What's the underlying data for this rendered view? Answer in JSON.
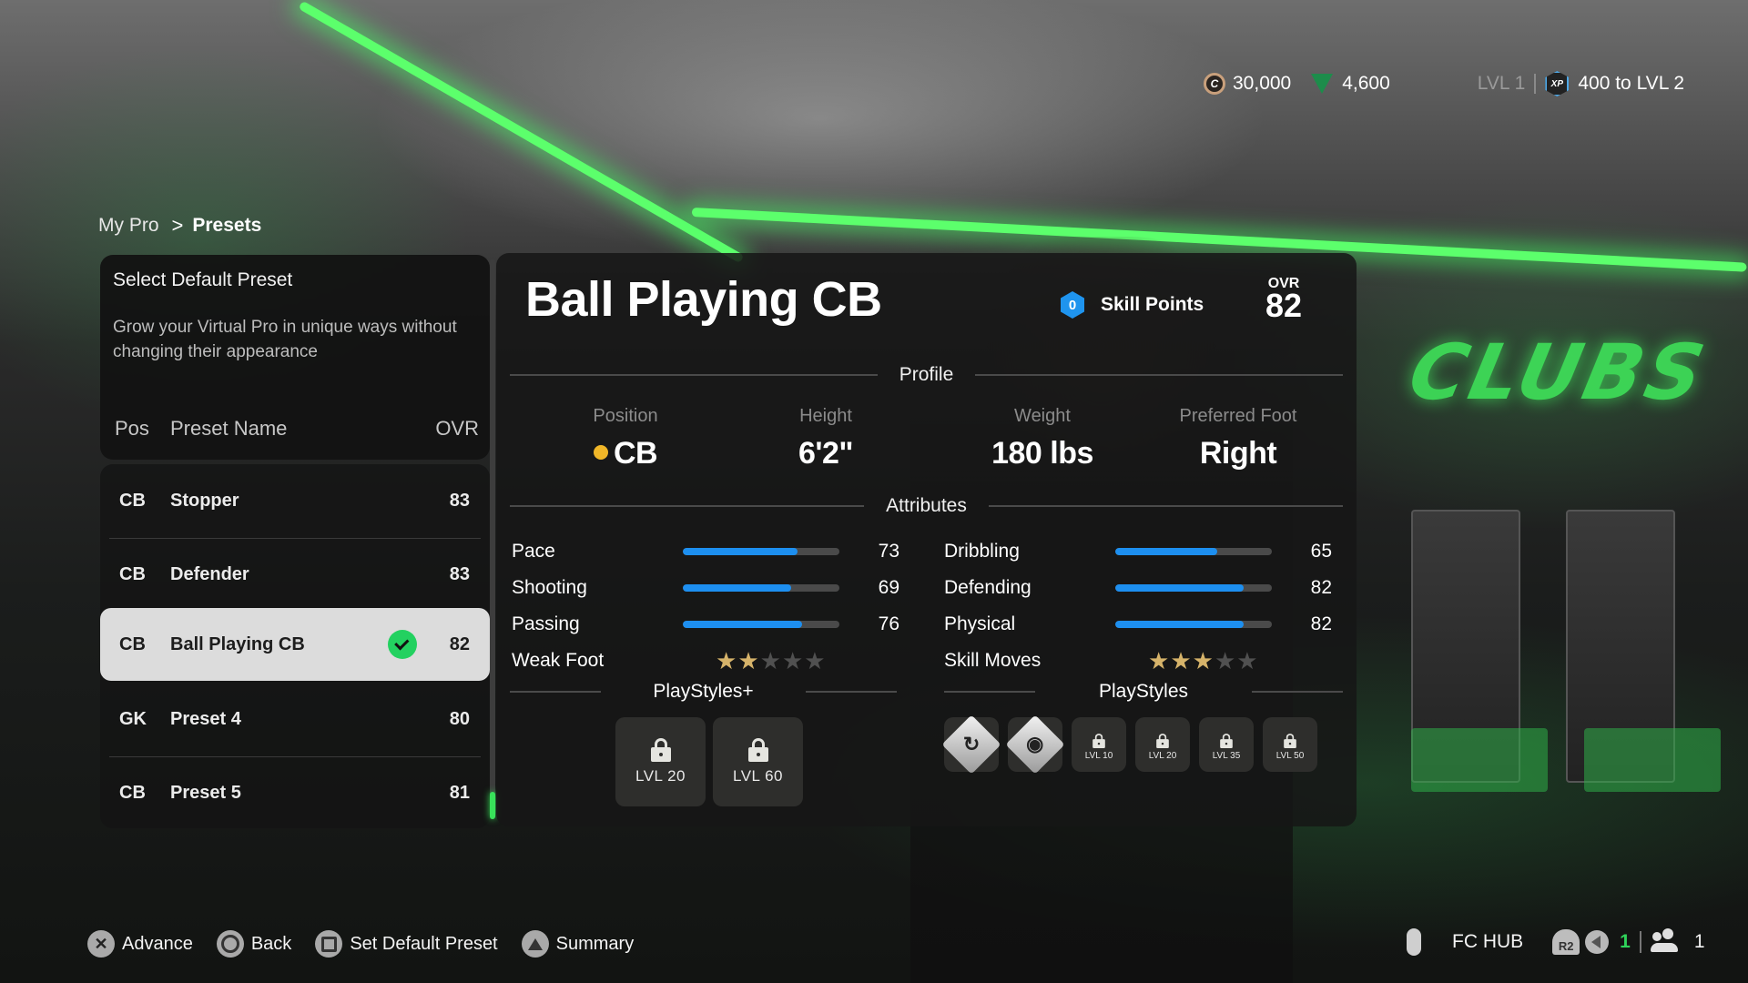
{
  "topbar": {
    "coins": "30,000",
    "points": "4,600",
    "level_current": "LVL 1",
    "xp_to_next": "400 to LVL 2",
    "icons": {
      "coins": "fc-coin-icon",
      "points": "fc-points-icon",
      "xp": "xp-badge-icon"
    }
  },
  "breadcrumb": {
    "root": "My Pro",
    "separator": ">",
    "current": "Presets"
  },
  "left_panel": {
    "title": "Select Default Preset",
    "description": "Grow your Virtual Pro in unique ways without changing their appearance",
    "columns": {
      "pos": "Pos",
      "name": "Preset Name",
      "ovr": "OVR"
    },
    "presets": [
      {
        "pos": "CB",
        "name": "Stopper",
        "ovr": "83",
        "selected": false,
        "default": false
      },
      {
        "pos": "CB",
        "name": "Defender",
        "ovr": "83",
        "selected": false,
        "default": false
      },
      {
        "pos": "CB",
        "name": "Ball Playing CB",
        "ovr": "82",
        "selected": true,
        "default": true
      },
      {
        "pos": "GK",
        "name": "Preset 4",
        "ovr": "80",
        "selected": false,
        "default": false
      },
      {
        "pos": "CB",
        "name": "Preset 5",
        "ovr": "81",
        "selected": false,
        "default": false
      }
    ]
  },
  "detail": {
    "title": "Ball Playing CB",
    "skill_points_value": "0",
    "skill_points_label": "Skill Points",
    "ovr_label": "OVR",
    "ovr_value": "82",
    "profile_heading": "Profile",
    "profile": {
      "position_label": "Position",
      "position_value": "CB",
      "height_label": "Height",
      "height_value": "6'2\"",
      "weight_label": "Weight",
      "weight_value": "180 lbs",
      "foot_label": "Preferred Foot",
      "foot_value": "Right"
    },
    "attributes_heading": "Attributes",
    "attributes_left": [
      {
        "name": "Pace",
        "value": 73
      },
      {
        "name": "Shooting",
        "value": 69
      },
      {
        "name": "Passing",
        "value": 76
      }
    ],
    "attributes_right": [
      {
        "name": "Dribbling",
        "value": 65
      },
      {
        "name": "Defending",
        "value": 82
      },
      {
        "name": "Physical",
        "value": 82
      }
    ],
    "weak_foot": {
      "label": "Weak Foot",
      "stars": 2,
      "max": 5
    },
    "skill_moves": {
      "label": "Skill Moves",
      "stars": 3,
      "max": 5
    },
    "playstyles_plus_heading": "PlayStyles+",
    "playstyles_plus": [
      {
        "locked": true,
        "unlock": "LVL 20"
      },
      {
        "locked": true,
        "unlock": "LVL 60"
      }
    ],
    "playstyles_heading": "PlayStyles",
    "playstyles": [
      {
        "locked": false,
        "icon": "intercept-arrows-icon"
      },
      {
        "locked": false,
        "icon": "raccoon-icon"
      },
      {
        "locked": true,
        "unlock": "LVL 10"
      },
      {
        "locked": true,
        "unlock": "LVL 20"
      },
      {
        "locked": true,
        "unlock": "LVL 35"
      },
      {
        "locked": true,
        "unlock": "LVL 50"
      }
    ],
    "colors": {
      "bar": "#1d8ff0",
      "star_on": "#d6b36a",
      "position_dot": "#f0b628",
      "check": "#23d160"
    }
  },
  "bottom_hints": [
    {
      "button": "cross",
      "label": "Advance"
    },
    {
      "button": "circle",
      "label": "Back"
    },
    {
      "button": "square",
      "label": "Set Default Preset"
    },
    {
      "button": "triangle",
      "label": "Summary"
    }
  ],
  "bottom_right": {
    "hub_label": "FC HUB",
    "r2_label": "R2",
    "voice_count": "1",
    "party_count": "1"
  },
  "background": {
    "wall_text": "CLUBS"
  }
}
